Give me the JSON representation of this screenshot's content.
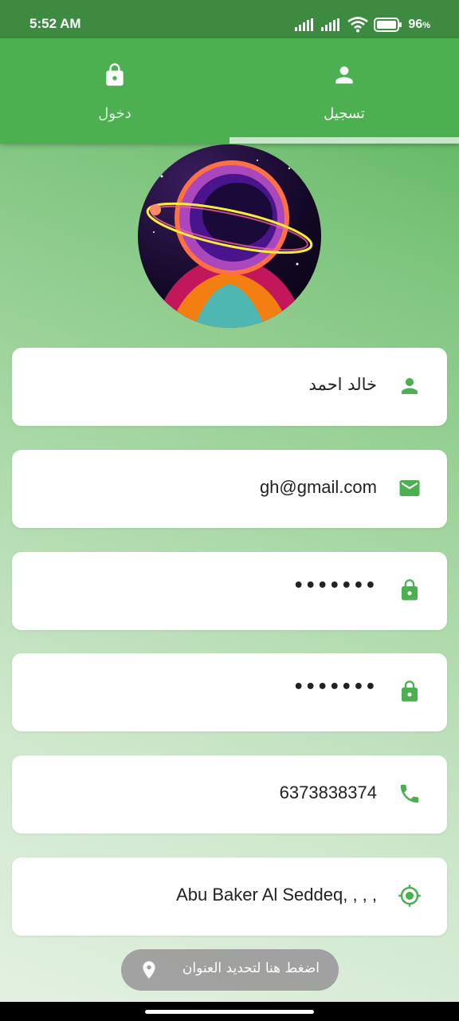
{
  "status_bar": {
    "time": "5:52 AM",
    "battery": "96",
    "battery_unit": "%"
  },
  "tabs": [
    {
      "label": "دخول",
      "icon": "lock-icon",
      "selected": false
    },
    {
      "label": "تسجيل",
      "icon": "person-icon",
      "selected": true
    }
  ],
  "avatar": {
    "icon": "astronaut-avatar"
  },
  "form": {
    "name": {
      "value": "خالد احمد",
      "icon": "person-icon"
    },
    "email": {
      "value": "gh@gmail.com",
      "icon": "email-icon"
    },
    "password": {
      "value": "•••••••",
      "icon": "lock-icon"
    },
    "confirm_password": {
      "value": "•••••••",
      "icon": "lock-icon"
    },
    "phone": {
      "value": "6373838374",
      "icon": "phone-icon"
    },
    "address": {
      "value": "Abu Baker Al Seddeq,  , , ,",
      "icon": "my-location-icon"
    }
  },
  "location_button": {
    "label": "اضغط هنا لتحديد العنوان",
    "icon": "location-pin-icon"
  },
  "colors": {
    "primary": "#4caf50",
    "status_bar": "#3d8b40",
    "icon": "#4caf50",
    "button": "#9e9e9e"
  }
}
